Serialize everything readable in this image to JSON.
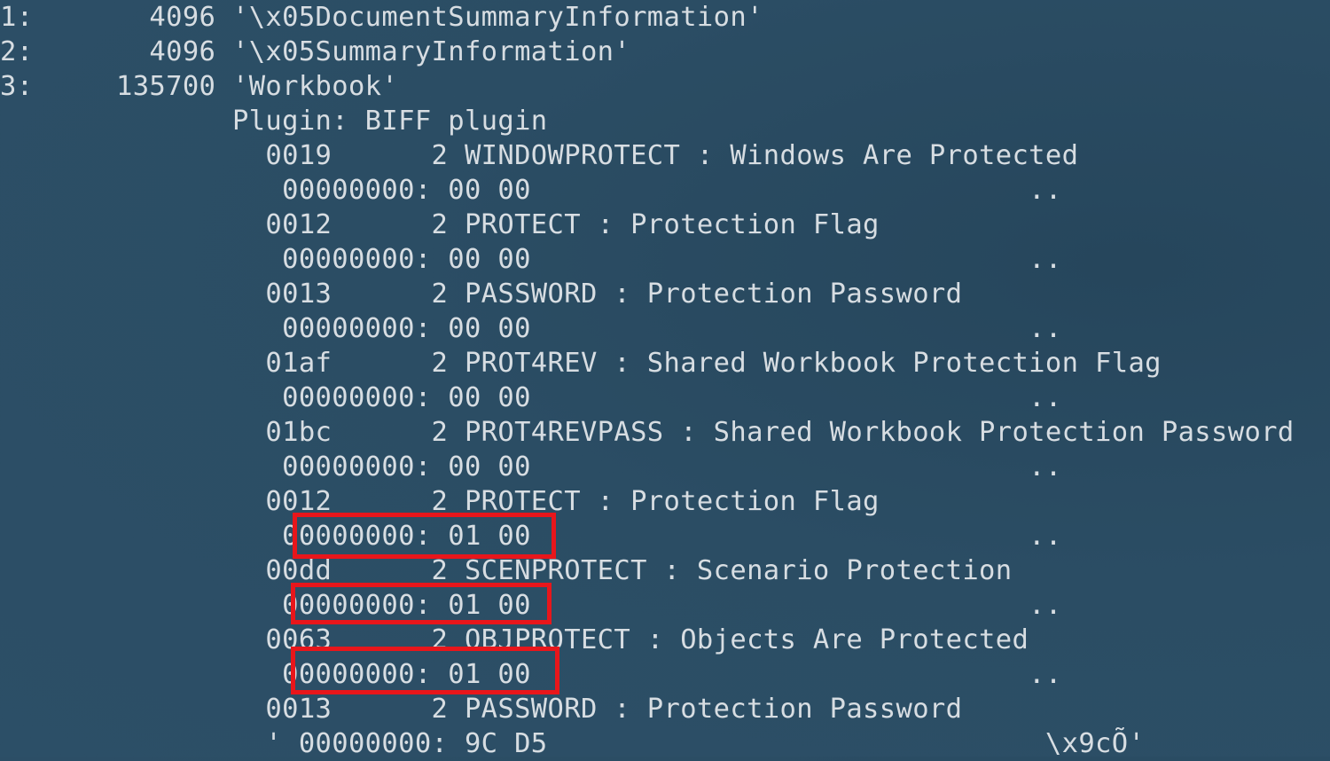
{
  "terminal": {
    "lines": [
      "1:       4096 '\\x05DocumentSummaryInformation'",
      "2:       4096 '\\x05SummaryInformation'",
      "3:     135700 'Workbook'",
      "              Plugin: BIFF plugin",
      "                0019      2 WINDOWPROTECT : Windows Are Protected",
      "                 00000000: 00 00                              ..",
      "                0012      2 PROTECT : Protection Flag",
      "                 00000000: 00 00                              ..",
      "                0013      2 PASSWORD : Protection Password",
      "                 00000000: 00 00                              ..",
      "                01af      2 PROT4REV : Shared Workbook Protection Flag",
      "                 00000000: 00 00                              ..",
      "                01bc      2 PROT4REVPASS : Shared Workbook Protection Password",
      "                 00000000: 00 00                              ..",
      "                0012      2 PROTECT : Protection Flag",
      "                 00000000: 01 00                              ..",
      "                00dd      2 SCENPROTECT : Scenario Protection",
      "                 00000000: 01 00                              ..",
      "                0063      2 OBJPROTECT : Objects Are Protected",
      "                 00000000: 01 00                              ..",
      "                0013      2 PASSWORD : Protection Password",
      "                ' 00000000: 9C D5                              \\x9cÕ'"
    ]
  },
  "colors": {
    "background": "#2b4d64",
    "text": "#d7dde2",
    "highlight_border": "#e8161b"
  }
}
